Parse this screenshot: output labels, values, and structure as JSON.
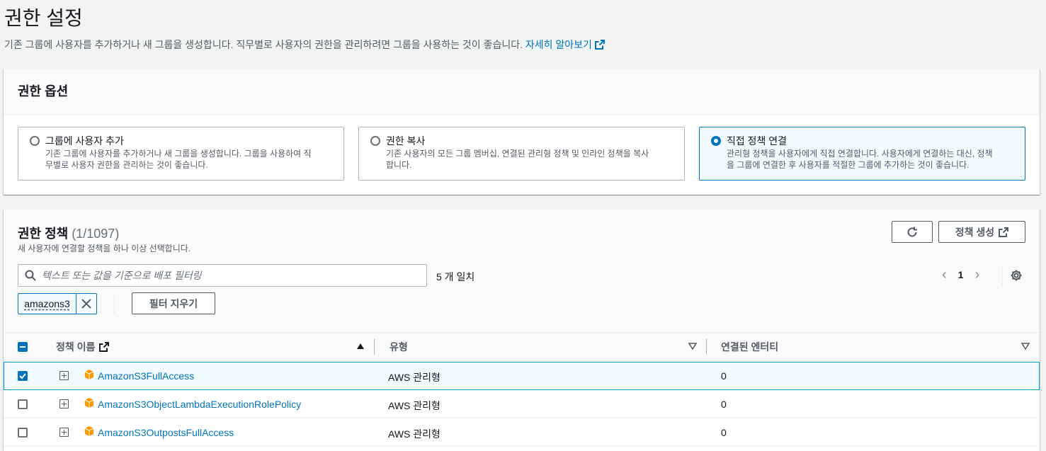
{
  "page": {
    "title": "권한 설정",
    "description": "기존 그룹에 사용자를 추가하거나 새 그룹을 생성합니다. 직무별로 사용자의 권한을 관리하려면 그룹을 사용하는 것이 좋습니다.",
    "learn_more": "자세히 알아보기"
  },
  "options_panel": {
    "title": "권한 옵션",
    "options": [
      {
        "title": "그룹에 사용자 추가",
        "desc1": "기존 그룹에 사용자를 추가하거나 새 그룹을 생성합니다. 그룹을 사용하여 직",
        "desc2": "무별로 사용자 권한을 관리하는 것이 좋습니다.",
        "selected": false
      },
      {
        "title": "권한 복사",
        "desc1": "기존 사용자의 모든 그룹 멤버십, 연결된 관리형 정책 및 인라인 정책을 복사",
        "desc2": "합니다.",
        "selected": false
      },
      {
        "title": "직접 정책 연결",
        "desc1": "관리형 정책을 사용자에게 직접 연결합니다. 사용자에게 연결하는 대신, 정책",
        "desc2": "을 그룹에 연결한 후 사용자를 적절한 그룹에 추가하는 것이 좋습니다.",
        "selected": true
      }
    ]
  },
  "policies_panel": {
    "title": "권한 정책",
    "count": "(1/1097)",
    "subtitle": "새 사용자에 연결할 정책을 하나 이상 선택합니다.",
    "create_button": "정책 생성",
    "search_placeholder": "텍스트 또는 값을 기준으로 배포 필터링",
    "match_text": "5 개 일치",
    "page_number": "1",
    "filter_token": "amazons3",
    "clear_filter": "필터 지우기",
    "columns": {
      "name": "정책 이름",
      "type": "유형",
      "entities": "연결된 엔터티"
    },
    "rows": [
      {
        "name": "AmazonS3FullAccess",
        "type": "AWS 관리형",
        "entities": "0",
        "checked": true
      },
      {
        "name": "AmazonS3ObjectLambdaExecutionRolePolicy",
        "type": "AWS 관리형",
        "entities": "0",
        "checked": false
      },
      {
        "name": "AmazonS3OutpostsFullAccess",
        "type": "AWS 관리형",
        "entities": "0",
        "checked": false
      }
    ]
  },
  "colors": {
    "accent": "#0073bb",
    "selected_bg": "#f1faff",
    "policy_icon": "#f90"
  },
  "icons": [
    "external-link-icon",
    "refresh-icon",
    "search-icon",
    "close-icon",
    "chevron-left-icon",
    "chevron-right-icon",
    "gear-icon",
    "sort-up-icon",
    "sort-down-icon",
    "expand-icon",
    "policy-box-icon"
  ]
}
